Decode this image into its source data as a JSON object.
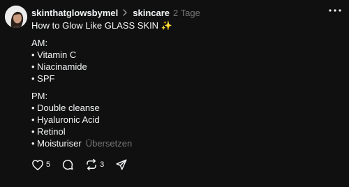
{
  "post": {
    "username": "skinthatglowsbymel",
    "community": "skincare",
    "time": "2 Tage",
    "title": "How to Glow Like GLASS SKIN ✨",
    "am_heading": "AM:",
    "am_items": [
      "• Vitamin C",
      "• Niacinamide",
      "• SPF"
    ],
    "pm_heading": "PM:",
    "pm_items": [
      "• Double cleanse",
      "• Hyaluronic Acid",
      "• Retinol",
      "• Moisturiser"
    ],
    "translate_label": "Übersetzen"
  },
  "actions": {
    "like_count": "5",
    "repost_count": "3"
  },
  "icons": {
    "more": "more-horizontal-icon",
    "like": "heart-icon",
    "reply": "comment-icon",
    "repost": "repost-icon",
    "share": "send-icon"
  },
  "colors": {
    "background": "#101010",
    "text": "#f3f5f7",
    "muted": "#777777"
  }
}
